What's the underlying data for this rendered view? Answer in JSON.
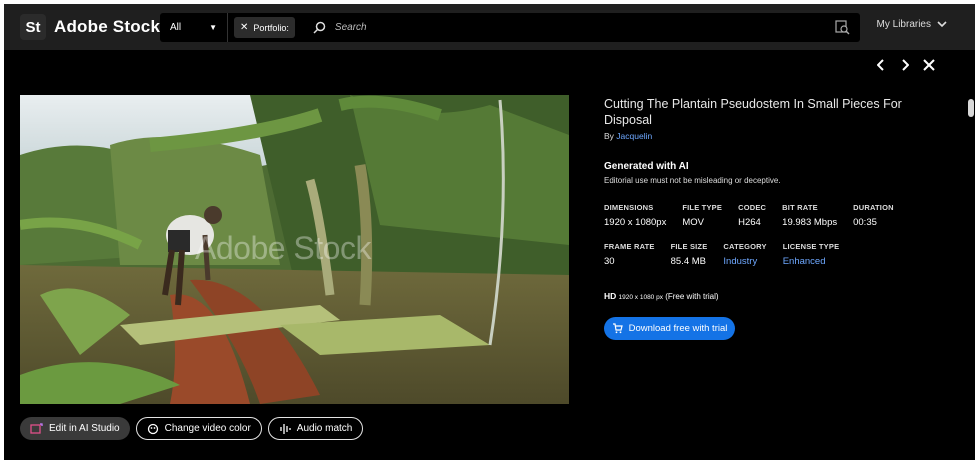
{
  "app": {
    "logo_mark": "St",
    "name": "Adobe Stock"
  },
  "search": {
    "filter_value": "All",
    "portfolio_chip": "Portfolio:",
    "placeholder": "Search",
    "libraries_label": "My Libraries"
  },
  "asset": {
    "watermark": "Adobe Stock",
    "title": "Cutting The Plantain Pseudostem In Small Pieces For Disposal",
    "by_prefix": "By",
    "author": "Jacquelin",
    "ai_heading": "Generated with AI",
    "ai_note": "Editorial use must not be misleading or deceptive.",
    "specs_row1": [
      {
        "label": "DIMENSIONS",
        "value": "1920 x 1080px"
      },
      {
        "label": "FILE TYPE",
        "value": "MOV"
      },
      {
        "label": "CODEC",
        "value": "H264"
      },
      {
        "label": "BIT RATE",
        "value": "19.983 Mbps"
      },
      {
        "label": "DURATION",
        "value": "00:35"
      }
    ],
    "specs_row2": [
      {
        "label": "FRAME RATE",
        "value": "30"
      },
      {
        "label": "FILE SIZE",
        "value": "85.4 MB"
      },
      {
        "label": "CATEGORY",
        "value": "Industry"
      },
      {
        "label": "LICENSE TYPE",
        "value": "Enhanced"
      }
    ],
    "hd_label": "HD",
    "hd_res": "1920 x 1080 px",
    "hd_note": "(Free with trial)",
    "download_label": "Download free with trial"
  },
  "actions": {
    "edit_ai": "Edit in AI Studio",
    "change_color": "Change video color",
    "audio_match": "Audio match"
  },
  "colors": {
    "accent_blue": "#1473e6",
    "link_blue": "#6ea8ff",
    "background": "#000000",
    "topbar": "#1f1f1f"
  }
}
